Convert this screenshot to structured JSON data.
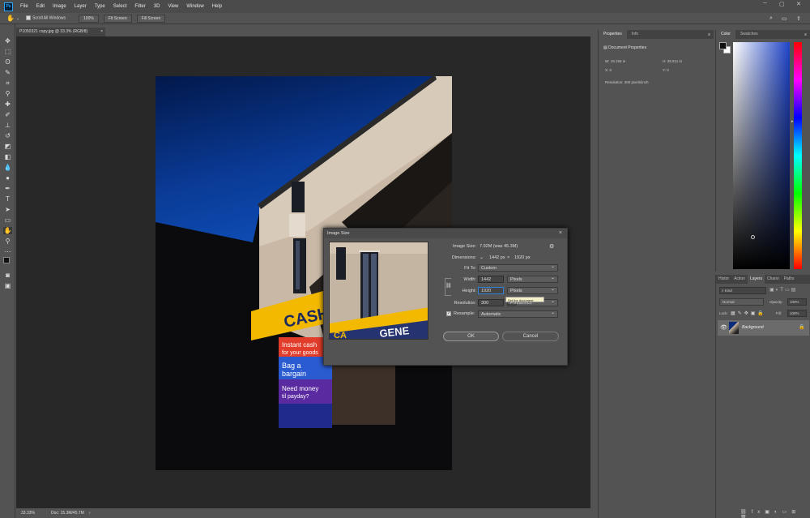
{
  "menubar": {
    "app_icon": "Ps",
    "items": [
      "File",
      "Edit",
      "Image",
      "Layer",
      "Type",
      "Select",
      "Filter",
      "3D",
      "View",
      "Window",
      "Help"
    ]
  },
  "optionsbar": {
    "scroll_all_windows": "Scroll All Windows",
    "zoom_100": "100%",
    "fit_screen": "Fit Screen",
    "fill_screen": "Fill Screen"
  },
  "document": {
    "tab_title": "P1050321 copy.jpg @ 33.3% (RGB/8)",
    "tab_close": "×"
  },
  "photo": {
    "sign_text": "CASH GE",
    "poster_lines": [
      "Instant cash",
      "for your goods",
      "Bag a",
      "bargain",
      "Need money",
      "til payday?"
    ],
    "preview_sign_text": "GENE",
    "preview_sign_prefix": "CA"
  },
  "statusbar": {
    "zoom": "33.33%",
    "doc_info": "Doc: 15.3M/45.7M"
  },
  "dialog": {
    "title": "Image Size",
    "close": "×",
    "image_size_label": "Image Size:",
    "image_size_value": "7.92M (was 45.3M)",
    "dimensions_label": "Dimensions:",
    "dimensions_width": "1442 px",
    "dimensions_x": "×",
    "dimensions_height": "1920 px",
    "fit_to_label": "Fit To:",
    "fit_to_value": "Custom",
    "width_label": "Width:",
    "width_value": "1442",
    "width_unit": "Pixels",
    "height_label": "Height:",
    "height_value": "1920",
    "height_unit": "Pixels",
    "resolution_label": "Resolution:",
    "resolution_value": "300",
    "resolution_unit": "Pixels/Inch",
    "resample_label": "Resample:",
    "resample_value": "Automatic",
    "tooltip": "Set the document height",
    "ok": "OK",
    "cancel": "Cancel"
  },
  "properties_panel": {
    "tabs": [
      "Properties",
      "Info"
    ],
    "header": "Document Properties",
    "w_label": "W:",
    "w_value": "19.156 in",
    "h_label": "H:",
    "h_value": "25.511 in",
    "x_label": "X:",
    "x_value": "0",
    "y_label": "Y:",
    "y_value": "0",
    "resolution": "Resolution: 300 pixels/inch"
  },
  "color_panel": {
    "tabs": [
      "Color",
      "Swatches"
    ]
  },
  "layers_panel": {
    "tabs": [
      "Histor",
      "Action",
      "Layers",
      "Chann",
      "Paths"
    ],
    "active_tab": "Layers",
    "search_placeholder": "Kind",
    "blend_mode": "Normal",
    "opacity_label": "Opacity:",
    "opacity_value": "100%",
    "lock_label": "Lock:",
    "fill_label": "Fill:",
    "fill_value": "100%",
    "layer_name": "Background"
  }
}
